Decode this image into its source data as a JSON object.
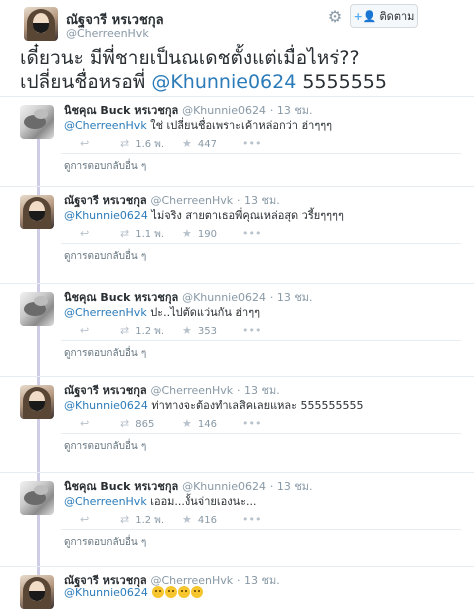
{
  "header": {
    "name": "ณัฐจารี หรเวชกุล",
    "handle": "@CherreenHvk",
    "follow_label": "ติดตาม"
  },
  "main_tweet": {
    "line1": "เดี๋ยวนะ มีพี่ชายเป็นณเดชตั้งแต่เมื่อไหร่??",
    "line2_prefix": "เปลี่ยนชื่อหรอพี่ ",
    "line2_mention": "@Khunnie0624",
    "line2_suffix": " 5555555"
  },
  "reply_prompt": "ดูการตอบกลับอื่น ๆ",
  "tweets": [
    {
      "name": "นิชคุณ Buck หรเวชกุล",
      "handle": "@Khunnie0624",
      "time": "· 13 ชม.",
      "mention": "@CherreenHvk",
      "text": " ใช่ เปลี่ยนชื่อเพราะเค้าหล่อกว่า ฮ่าๆๆๆ",
      "retweets": "1.6 พ.",
      "likes": "447"
    },
    {
      "name": "ณัฐจารี หรเวชกุล",
      "handle": "@CherreenHvk",
      "time": "· 13 ชม.",
      "mention": "@Khunnie0624",
      "text": " ไม่จริง สายตาเธอพี่คุณเหล่อสุด วรี้ยๆๆๆๆ",
      "retweets": "1.1 พ.",
      "likes": "190"
    },
    {
      "name": "นิชคุณ Buck หรเวชกุล",
      "handle": "@Khunnie0624",
      "time": "· 13 ชม.",
      "mention": "@CherreenHvk",
      "text": " ปะ..ไปตัดแว่นกัน ฮ่าๆๆ",
      "retweets": "1.2 พ.",
      "likes": "353"
    },
    {
      "name": "ณัฐจารี หรเวชกุล",
      "handle": "@CherreenHvk",
      "time": "· 13 ชม.",
      "mention": "@Khunnie0624",
      "text": " ท่าทางจะต้องทำเลสิคเลยแหละ 555555555",
      "retweets": "865",
      "likes": "146"
    },
    {
      "name": "นิชคุณ Buck หรเวชกุล",
      "handle": "@Khunnie0624",
      "time": "· 13 ชม.",
      "mention": "@CherreenHvk",
      "text": " เออม...งั้นจ่ายเองนะ...",
      "retweets": "1.2 พ.",
      "likes": "416"
    },
    {
      "name": "ณัฐจารี หรเวชกุล",
      "handle": "@CherreenHvk",
      "time": "· 13 ชม.",
      "mention": "@Khunnie0624",
      "text": " ",
      "retweets": "",
      "likes": ""
    }
  ],
  "icons": {
    "gear": "gear-icon",
    "follow": "add-user-icon",
    "reply": "reply-icon",
    "retweet": "retweet-icon",
    "like": "star-icon",
    "more": "more-icon"
  },
  "colors": {
    "link": "#2b7bb9",
    "muted": "#8899a6",
    "thread_line": "#cfcde6",
    "border": "#e6ecf0"
  }
}
